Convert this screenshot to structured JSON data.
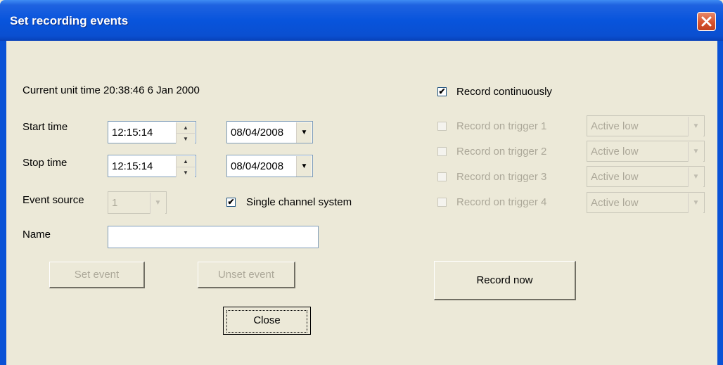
{
  "window": {
    "title": "Set recording events"
  },
  "current_time": "Current unit time 20:38:46 6 Jan 2000",
  "start": {
    "label": "Start time",
    "time": "12:15:14",
    "date": "08/04/2008"
  },
  "stop": {
    "label": "Stop time",
    "time": "12:15:14",
    "date": "08/04/2008"
  },
  "event_source": {
    "label": "Event source",
    "value": "1"
  },
  "single_channel": {
    "label": "Single channel system",
    "checked": true
  },
  "name": {
    "label": "Name",
    "value": ""
  },
  "buttons": {
    "set_event": "Set event",
    "unset_event": "Unset event",
    "close": "Close",
    "record_now": "Record now"
  },
  "record_continuously": {
    "label": "Record continuously",
    "checked": true
  },
  "triggers": [
    {
      "label": "Record on trigger 1",
      "value": "Active low"
    },
    {
      "label": "Record on trigger 2",
      "value": "Active low"
    },
    {
      "label": "Record on trigger 3",
      "value": "Active low"
    },
    {
      "label": "Record on trigger 4",
      "value": "Active low"
    }
  ],
  "colors": {
    "title_bar": "#0854dc",
    "dialog_bg": "#ece9d8",
    "disabled_text": "#aca899",
    "close_button": "#d7532e"
  },
  "icons": {
    "close": "close-icon",
    "spin_up": "spin-up-icon",
    "spin_down": "spin-down-icon",
    "dropdown": "chevron-down-icon",
    "check": "checkmark-icon"
  }
}
